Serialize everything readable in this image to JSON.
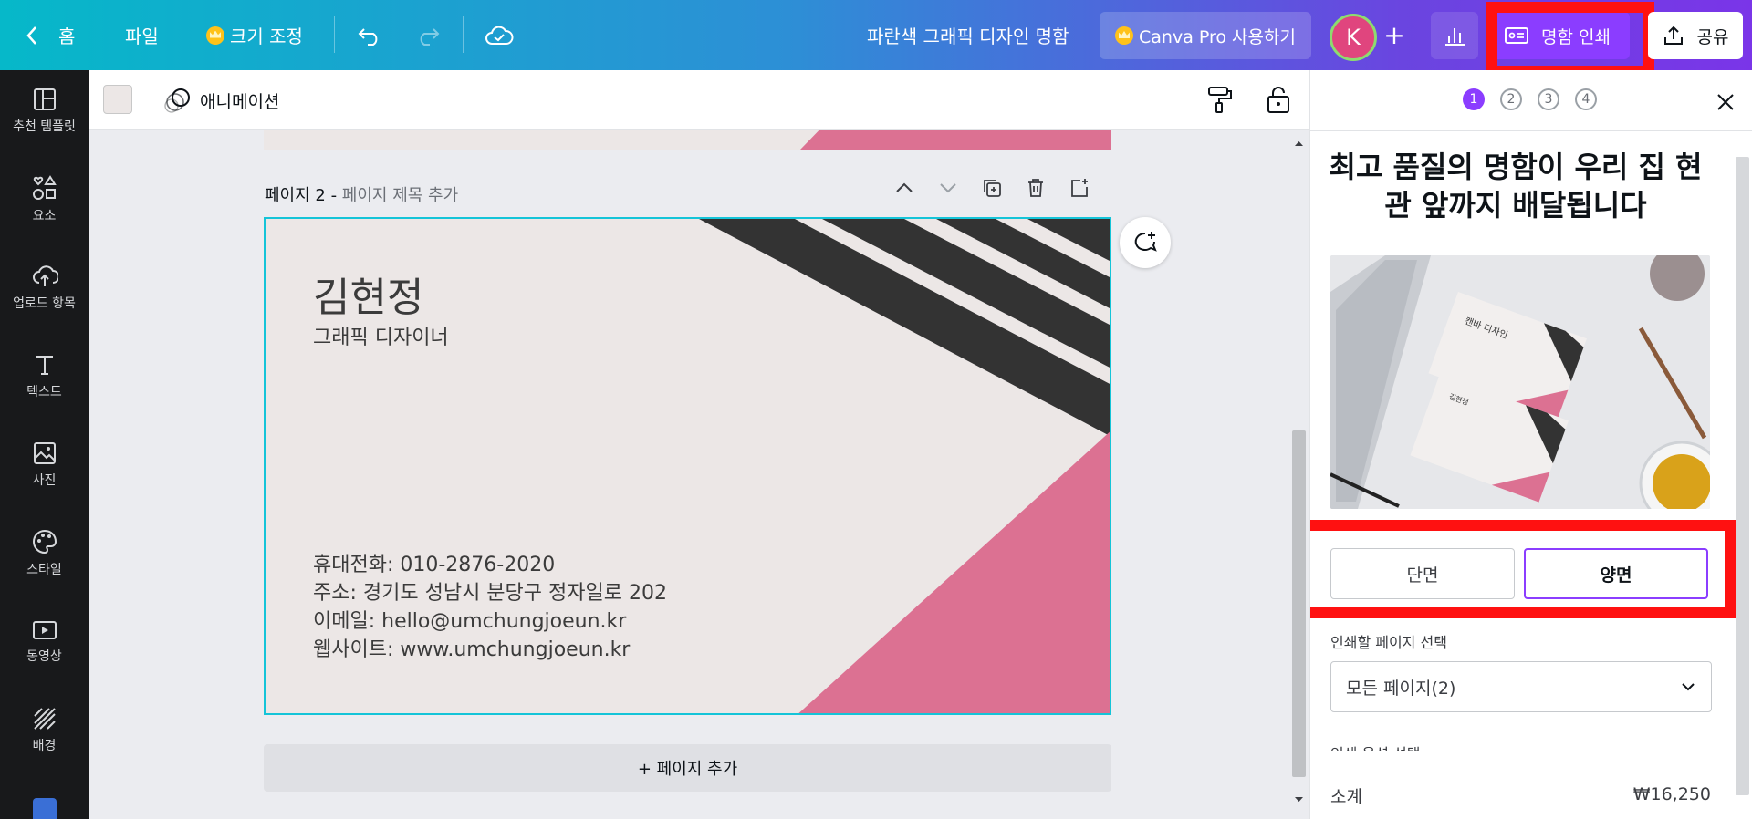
{
  "topbar": {
    "home_label": "홈",
    "file_label": "파일",
    "resize_label": "크기 조정",
    "doc_title": "파란색 그래픽 디자인 명함",
    "pro_label": "Canva Pro 사용하기",
    "avatar_initial": "K",
    "print_label": "명함 인쇄",
    "share_label": "공유"
  },
  "sidebar": {
    "items": [
      {
        "label": "추천 템플릿",
        "icon": "template-icon"
      },
      {
        "label": "요소",
        "icon": "elements-icon"
      },
      {
        "label": "업로드 항목",
        "icon": "upload-icon"
      },
      {
        "label": "텍스트",
        "icon": "text-icon"
      },
      {
        "label": "사진",
        "icon": "photo-icon"
      },
      {
        "label": "스타일",
        "icon": "palette-icon"
      },
      {
        "label": "동영상",
        "icon": "video-icon"
      },
      {
        "label": "배경",
        "icon": "background-icon"
      }
    ]
  },
  "toolbar": {
    "animation_label": "애니메이션",
    "swatch_color": "#ece7e6"
  },
  "canvas": {
    "page_label": "페이지 2 - ",
    "page_title_placeholder": "페이지 제목 추가",
    "add_page_label": "+ 페이지 추가",
    "card": {
      "name": "김현정",
      "role": "그래픽 디자이너",
      "phone": "휴대전화: 010-2876-2020",
      "address": "주소: 경기도 성남시 분당구 정자일로 202",
      "email": "이메일: hello@umchungjoeun.kr",
      "website": "웹사이트: www.umchungjoeun.kr",
      "bg_color": "#ece7e6",
      "stripe_color": "#333333",
      "accent_color": "#dc7192"
    }
  },
  "panel": {
    "steps": [
      "1",
      "2",
      "3",
      "4"
    ],
    "active_step": "1",
    "title": "최고 품질의 명함이 우리 집 현관 앞까지 배달됩니다",
    "single_side_label": "단면",
    "double_side_label": "양면",
    "pages_label": "인쇄할 페이지 선택",
    "pages_value": "모든 페이지(2)",
    "options_label": "인쇄 옵션 선택",
    "subtotal_label": "소계",
    "subtotal_value": "₩16,250",
    "photo_card_title": "캔바 디자인",
    "photo_card_name": "김현정"
  },
  "colors": {
    "accent_purple": "#8b3dff",
    "highlight_red": "#ff1111",
    "selection_teal": "#14c4d8"
  }
}
